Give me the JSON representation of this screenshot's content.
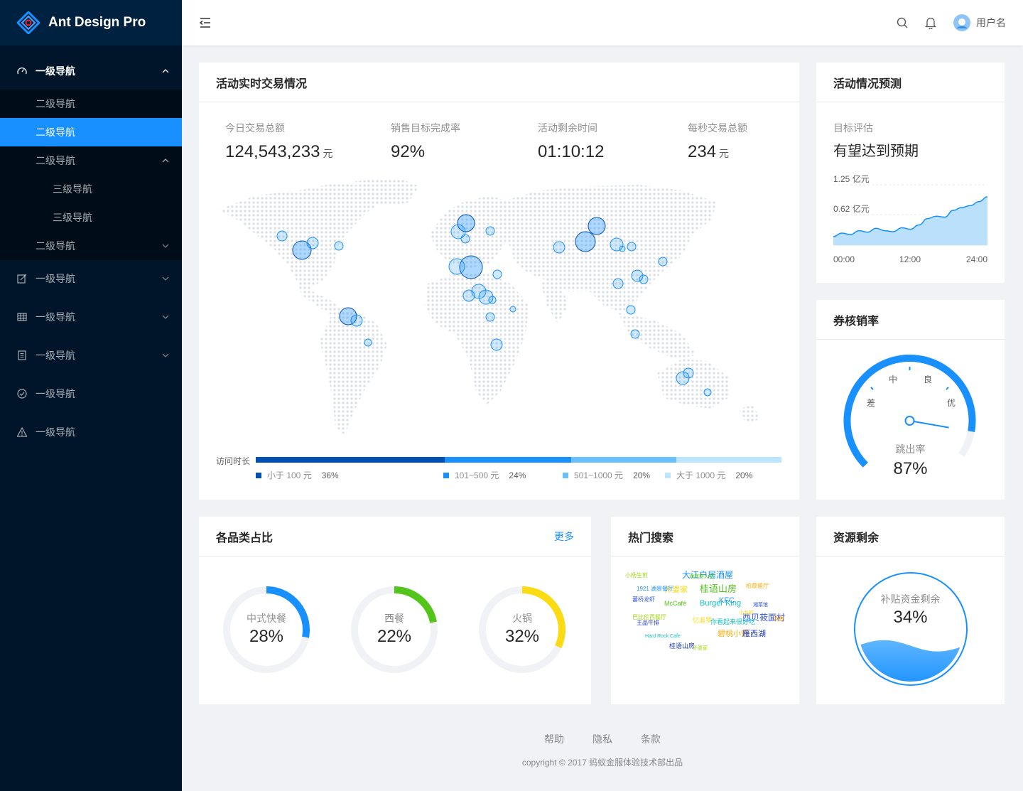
{
  "app": {
    "title": "Ant Design Pro"
  },
  "header": {
    "user_name": "用户名"
  },
  "sidebar": {
    "items": [
      {
        "label": "一级导航",
        "icon": "dashboard-icon",
        "expanded": true
      },
      {
        "label": "二级导航"
      },
      {
        "label": "二级导航",
        "selected": true
      },
      {
        "label": "二级导航",
        "expanded": true
      },
      {
        "label": "三级导航"
      },
      {
        "label": "三级导航"
      },
      {
        "label": "二级导航"
      },
      {
        "label": "一级导航",
        "icon": "form-icon"
      },
      {
        "label": "一级导航",
        "icon": "table-icon"
      },
      {
        "label": "一级导航",
        "icon": "profile-icon"
      },
      {
        "label": "一级导航",
        "icon": "check-circle-icon"
      },
      {
        "label": "一级导航",
        "icon": "warning-icon"
      }
    ]
  },
  "realtime": {
    "title": "活动实时交易情况",
    "stats": [
      {
        "label": "今日交易总额",
        "value": "124,543,233",
        "unit": "元"
      },
      {
        "label": "销售目标完成率",
        "value": "92%",
        "unit": ""
      },
      {
        "label": "活动剩余时间",
        "value": "01:10:12",
        "unit": ""
      },
      {
        "label": "每秒交易总额",
        "value": "234",
        "unit": "元"
      }
    ],
    "duration_label": "访问时长",
    "legend": [
      {
        "label": "小于 100 元",
        "pct": "36%",
        "color": "#0050b3",
        "fraction": 0.36
      },
      {
        "label": "101~500 元",
        "pct": "24%",
        "color": "#1890ff",
        "fraction": 0.24
      },
      {
        "label": "501~1000 元",
        "pct": "20%",
        "color": "#69c0ff",
        "fraction": 0.2
      },
      {
        "label": "大于 1000 元",
        "pct": "20%",
        "color": "#bae7ff",
        "fraction": 0.2
      }
    ]
  },
  "forecast": {
    "title": "活动情况预测",
    "label": "目标评估",
    "value": "有望达到预期",
    "chart_data": {
      "type": "area",
      "x": [
        "00:00",
        "12:00",
        "24:00"
      ],
      "yticks": [
        "1.25 亿元",
        "0.62 亿元"
      ],
      "ylim": [
        0,
        1.25
      ],
      "values": [
        0.18,
        0.25,
        0.22,
        0.3,
        0.27,
        0.35,
        0.3,
        0.28,
        0.36,
        0.33,
        0.42,
        0.55,
        0.6,
        0.58,
        0.72,
        0.78,
        0.82,
        0.9,
        1.0
      ],
      "grid": true
    }
  },
  "gauge": {
    "title": "券核销率",
    "ticks": [
      "差",
      "中",
      "良",
      "优"
    ],
    "label": "跳出率",
    "value": "87%",
    "fraction": 0.87
  },
  "category": {
    "title": "各品类占比",
    "more": "更多",
    "items": [
      {
        "name": "中式快餐",
        "pct": "28%",
        "fraction": 0.28,
        "color": "#1890ff"
      },
      {
        "name": "西餐",
        "pct": "22%",
        "fraction": 0.22,
        "color": "#52c41a"
      },
      {
        "name": "火锅",
        "pct": "32%",
        "fraction": 0.32,
        "color": "#fadb14"
      }
    ]
  },
  "hot": {
    "title": "热门搜索",
    "words": [
      "大江户居酒屋",
      "桂语山房",
      "外婆家",
      "Burger King",
      "西贝莜面村",
      "碧桃小馆",
      "雁西湖",
      "小杨生煎",
      "KFC",
      "McCafé",
      "忆遥罗",
      "你看起来很好吃",
      "蕃桥龙虾",
      "柏慕盟厅",
      "王品牛排",
      "巴比伦西餐厅",
      "1921 湖景餐厅",
      "海底捞火锅",
      "小龙虾",
      "Hard Rock Cafe",
      "湘菜馆",
      "酒香",
      "桂语山房",
      "外婆家"
    ]
  },
  "resource": {
    "title": "资源剩余",
    "label": "补贴资金剩余",
    "value": "34%",
    "fraction": 0.34
  },
  "footer": {
    "links": [
      "帮助",
      "隐私",
      "条款"
    ],
    "copyright": "copyright © 2017 蚂蚁金服体验技术部出品"
  },
  "map": {
    "bubbles": [
      {
        "x": 425,
        "y": 352,
        "r": 13
      },
      {
        "x": 397,
        "y": 332,
        "r": 7
      },
      {
        "x": 440,
        "y": 342,
        "r": 8
      },
      {
        "x": 477,
        "y": 346,
        "r": 6
      },
      {
        "x": 490,
        "y": 445,
        "r": 12
      },
      {
        "x": 502,
        "y": 451,
        "r": 8
      },
      {
        "x": 518,
        "y": 482,
        "r": 5
      },
      {
        "x": 656,
        "y": 314,
        "r": 12
      },
      {
        "x": 645,
        "y": 326,
        "r": 10
      },
      {
        "x": 655,
        "y": 336,
        "r": 6
      },
      {
        "x": 690,
        "y": 325,
        "r": 6
      },
      {
        "x": 663,
        "y": 376,
        "r": 16
      },
      {
        "x": 643,
        "y": 375,
        "r": 11
      },
      {
        "x": 700,
        "y": 386,
        "r": 6
      },
      {
        "x": 674,
        "y": 410,
        "r": 10
      },
      {
        "x": 660,
        "y": 416,
        "r": 8
      },
      {
        "x": 684,
        "y": 418,
        "r": 10
      },
      {
        "x": 693,
        "y": 422,
        "r": 5
      },
      {
        "x": 690,
        "y": 446,
        "r": 6
      },
      {
        "x": 722,
        "y": 435,
        "r": 4
      },
      {
        "x": 699,
        "y": 485,
        "r": 8
      },
      {
        "x": 824,
        "y": 340,
        "r": 14
      },
      {
        "x": 840,
        "y": 318,
        "r": 12
      },
      {
        "x": 787,
        "y": 348,
        "r": 8
      },
      {
        "x": 868,
        "y": 344,
        "r": 9
      },
      {
        "x": 876,
        "y": 350,
        "r": 4
      },
      {
        "x": 889,
        "y": 347,
        "r": 6
      },
      {
        "x": 933,
        "y": 368,
        "r": 6
      },
      {
        "x": 897,
        "y": 388,
        "r": 8
      },
      {
        "x": 906,
        "y": 393,
        "r": 6
      },
      {
        "x": 870,
        "y": 399,
        "r": 7
      },
      {
        "x": 888,
        "y": 436,
        "r": 6
      },
      {
        "x": 894,
        "y": 470,
        "r": 6
      },
      {
        "x": 961,
        "y": 532,
        "r": 9
      },
      {
        "x": 969,
        "y": 525,
        "r": 7
      },
      {
        "x": 996,
        "y": 552,
        "r": 5
      }
    ]
  }
}
